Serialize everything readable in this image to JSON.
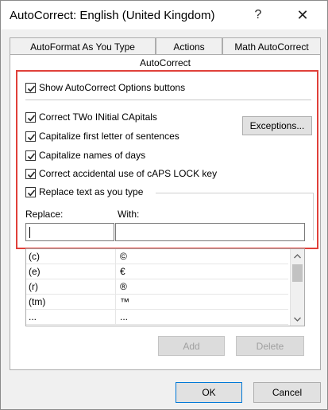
{
  "window": {
    "title": "AutoCorrect: English (United Kingdom)",
    "help_glyph": "?",
    "close_glyph": "✕"
  },
  "tabs": {
    "row1": [
      "AutoFormat As You Type",
      "Actions",
      "Math AutoCorrect"
    ],
    "active": "AutoCorrect"
  },
  "options": {
    "show_buttons": {
      "label": "Show AutoCorrect Options buttons",
      "checked": true
    },
    "two_initial": {
      "label": "Correct TWo INitial CApitals",
      "checked": true
    },
    "first_letter": {
      "label": "Capitalize first letter of sentences",
      "checked": true
    },
    "days": {
      "label": "Capitalize names of days",
      "checked": true
    },
    "caps_lock": {
      "label": "Correct accidental use of cAPS LOCK key",
      "checked": true
    },
    "replace_text": {
      "label": "Replace text as you type",
      "checked": true
    }
  },
  "buttons": {
    "exceptions": "Exceptions...",
    "add": "Add",
    "delete": "Delete",
    "ok": "OK",
    "cancel": "Cancel"
  },
  "replace": {
    "replace_label": "Replace:",
    "with_label": "With:",
    "replace_value": "",
    "with_value": ""
  },
  "list": {
    "rows": [
      {
        "replace": "(c)",
        "with": "©"
      },
      {
        "replace": "(e)",
        "with": "€"
      },
      {
        "replace": "(r)",
        "with": "®"
      },
      {
        "replace": "(tm)",
        "with": "™"
      },
      {
        "replace": "...",
        "with": "..."
      }
    ]
  },
  "colors": {
    "highlight": "#e0403a",
    "dialog_bg": "#f0f0f0"
  }
}
